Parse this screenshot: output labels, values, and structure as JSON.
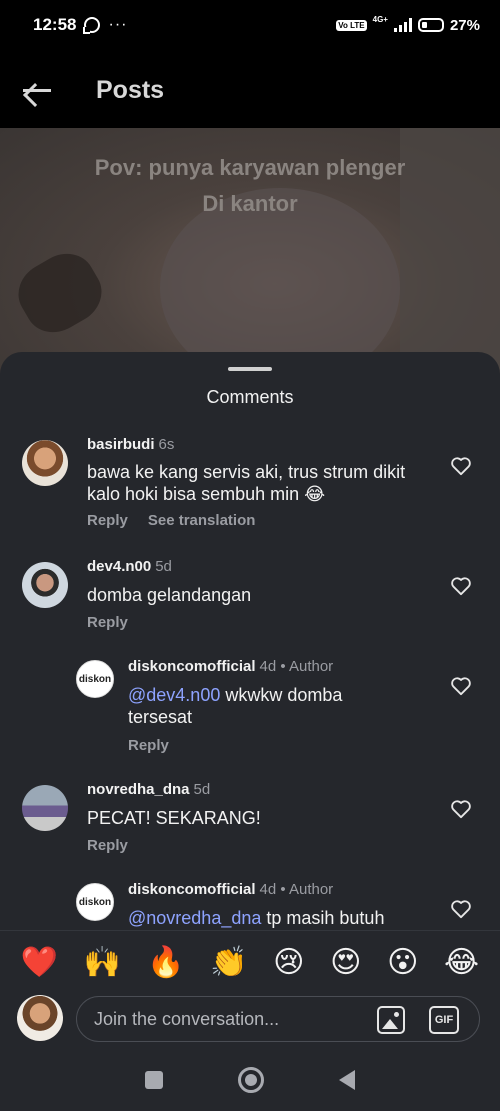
{
  "status_bar": {
    "time": "12:58",
    "more": "···",
    "volte": "Vo LTE",
    "network": "4G+",
    "battery_percent": "27%",
    "battery_level": 0.27
  },
  "header": {
    "title": "Posts"
  },
  "video": {
    "caption_line1": "Pov: punya karyawan plenger",
    "caption_line2": "Di kantor"
  },
  "sheet": {
    "title": "Comments"
  },
  "comments": [
    {
      "user": "basirbudi",
      "time": "6s",
      "text": "bawa ke kang servis aki, trus strum dikit kalo hoki bisa sembuh min 😂",
      "reply_label": "Reply",
      "translate_label": "See translation"
    },
    {
      "user": "dev4.n00",
      "time": "5d",
      "text": "domba gelandangan",
      "reply_label": "Reply"
    },
    {
      "user": "diskoncomofficial",
      "time": "4d",
      "author_label": "• Author",
      "mention": "@dev4.n00",
      "text": " wkwkw domba tersesat",
      "reply_label": "Reply",
      "avatar_text": "diskon"
    },
    {
      "user": "novredha_dna",
      "time": "5d",
      "text": "PECAT! SEKARANG!",
      "reply_label": "Reply"
    },
    {
      "user": "diskoncomofficial",
      "time": "4d",
      "author_label": "• Author",
      "mention": "@novredha_dna",
      "text": " tp masih butuh",
      "avatar_text": "diskon"
    }
  ],
  "emoji_bar": [
    "❤️",
    "🙌",
    "🔥",
    "👏",
    "😢",
    "😍",
    "😮",
    "😂"
  ],
  "composer": {
    "placeholder": "Join the conversation...",
    "image_icon": "image-icon",
    "gif_label": "GIF"
  },
  "nav": {
    "recents": "square-icon",
    "home": "circle-icon",
    "back": "triangle-back-icon"
  }
}
